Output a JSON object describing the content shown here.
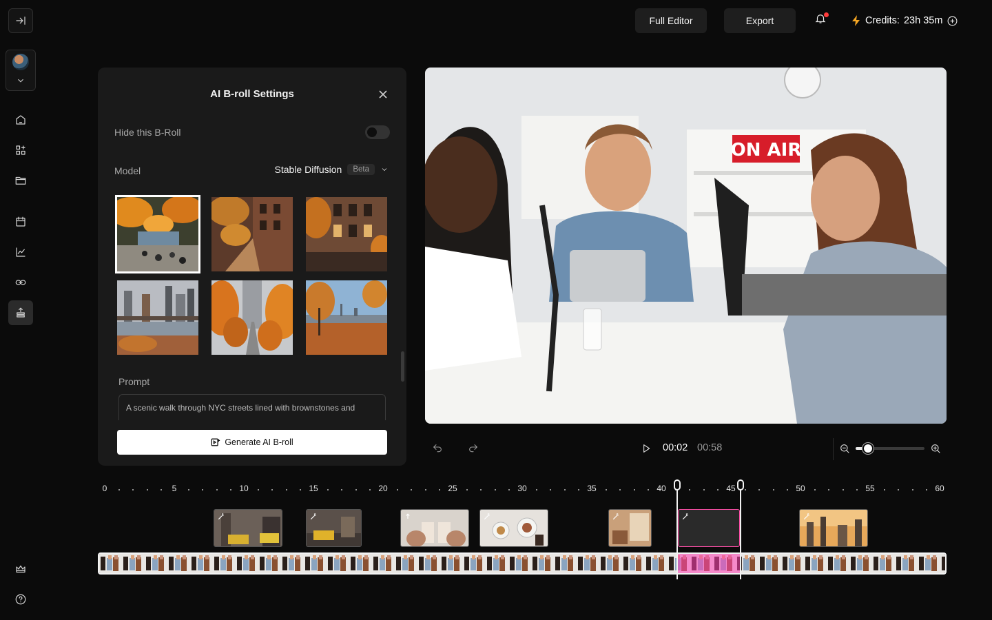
{
  "topbar": {
    "full_editor": "Full Editor",
    "export": "Export",
    "credits_label": "Credits:",
    "credits_value": "23h 35m"
  },
  "panel": {
    "title": "AI B-roll Settings",
    "hide_label": "Hide this B-Roll",
    "hide_enabled": false,
    "model_label": "Model",
    "model_value": "Stable Diffusion",
    "model_badge": "Beta",
    "prompt_label": "Prompt",
    "prompt_value": "A scenic walk through NYC streets lined with brownstones and",
    "generate_label": "Generate AI B-roll",
    "selected_thumbnail": 0
  },
  "player": {
    "current_time": "00:02",
    "total_time": "00:58",
    "zoom_level": 0.18
  },
  "timeline": {
    "ticks": [
      "0",
      "5",
      "10",
      "15",
      "20",
      "25",
      "30",
      "35",
      "40",
      "45",
      "50",
      "55",
      "60"
    ]
  },
  "colors": {
    "accent": "#ff4fa8",
    "bolt": "#f5a623",
    "notify": "#ff3b3b"
  }
}
